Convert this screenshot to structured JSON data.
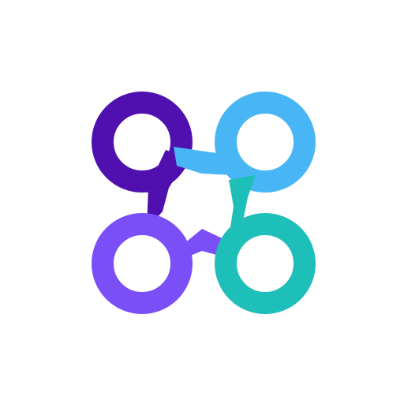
{
  "logo": {
    "icon": "four-rotor-drone-icon",
    "colors": {
      "top_left": "#5010B0",
      "top_right": "#48B6F4",
      "bottom_left": "#7A4FF7",
      "bottom_right": "#1DBFB8",
      "background": "#FFFFFF"
    }
  }
}
